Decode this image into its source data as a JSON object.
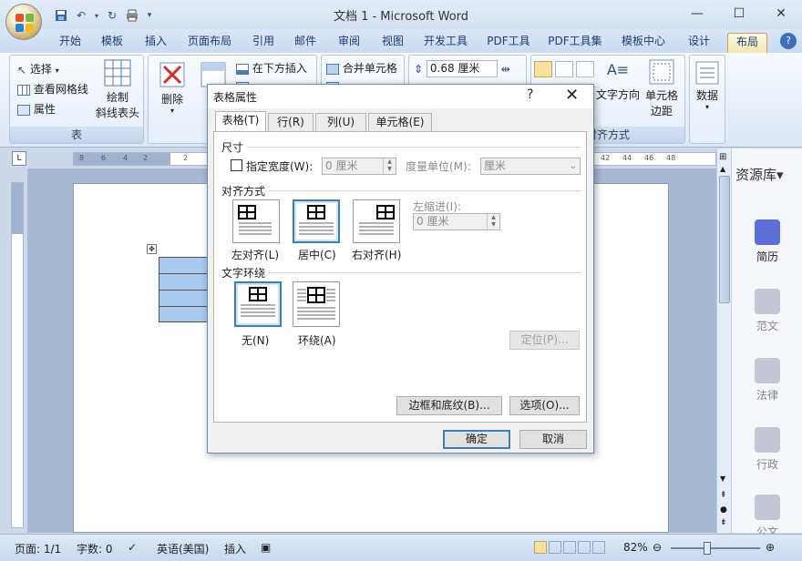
{
  "window": {
    "title": "文档 1 - Microsoft Word"
  },
  "qat": {
    "save": "save-icon",
    "undo": "undo-icon",
    "redo": "redo-icon",
    "print": "print-icon",
    "customize": "▾"
  },
  "tabs": [
    "开始",
    "模板",
    "插入",
    "页面布局",
    "引用",
    "邮件",
    "审阅",
    "视图",
    "开发工具",
    "PDF工具",
    "PDF工具集",
    "模板中心",
    "设计",
    "布局"
  ],
  "active_tab": "布局",
  "ribbon": {
    "table_group": {
      "label": "表",
      "select": "选择",
      "gridlines": "查看网格线",
      "properties": "属性",
      "draw_diag_1": "绘制",
      "draw_diag_2": "斜线表头"
    },
    "delete": "删除",
    "insert_partial": "在",
    "insert_below": "在下方插入",
    "merge_cells": "合并单元格",
    "row_height": "0.68 厘米",
    "text_direction": "文字方向",
    "cell_margins_1": "单元格",
    "cell_margins_2": "边距",
    "alignment_label": "对齐方式",
    "data": "数据"
  },
  "ruler": {
    "corner": "L",
    "left_ticks": [
      "8",
      "6",
      "4",
      "2"
    ],
    "mid_tick": "2",
    "right_ticks": [
      "42",
      "44",
      "46",
      "48"
    ]
  },
  "dialog": {
    "title": "表格属性",
    "help": "?",
    "close": "✕",
    "tabs": [
      "表格(T)",
      "行(R)",
      "列(U)",
      "单元格(E)"
    ],
    "size_section": "尺寸",
    "specify_width": "指定宽度(W):",
    "width_value": "0 厘米",
    "measure_in": "度量单位(M):",
    "measure_value": "厘米",
    "alignment_section": "对齐方式",
    "align_left": "左对齐(L)",
    "align_center": "居中(C)",
    "align_right": "右对齐(H)",
    "indent_label": "左缩进(I):",
    "indent_value": "0 厘米",
    "wrap_section": "文字环绕",
    "wrap_none": "无(N)",
    "wrap_around": "环绕(A)",
    "positioning": "定位(P)...",
    "borders_shading": "边框和底纹(B)...",
    "options": "选项(O)...",
    "ok": "确定",
    "cancel": "取消"
  },
  "resource_panel": {
    "title": "资源库▾",
    "items": [
      "简历",
      "范文",
      "法律",
      "行政",
      "公文"
    ]
  },
  "status": {
    "page": "页面: 1/1",
    "words": "字数: 0",
    "language": "英语(美国)",
    "mode": "插入",
    "zoom": "82%"
  },
  "colors": {
    "ribbon_blue": "#dce7f5",
    "active_tab": "#f7e8b3",
    "table_fill": "#a9c9ef",
    "dialog_accent": "#3c7fb1"
  }
}
